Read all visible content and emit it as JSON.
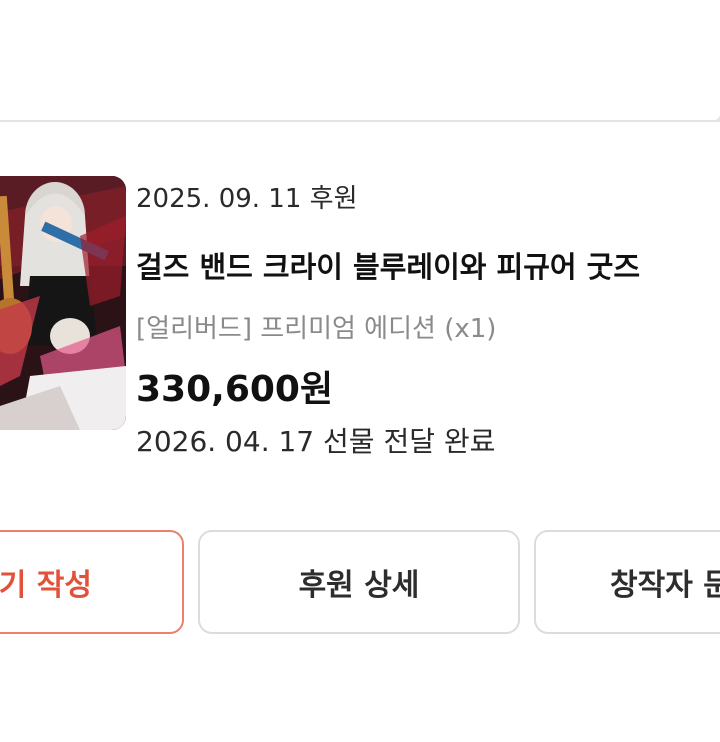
{
  "card": {
    "support_date": "2025. 09. 11 후원",
    "title": "걸즈 밴드 크라이 블루레이와 피규어 굿즈",
    "option": "[얼리버드] 프리미엄 에디션 (x1)",
    "price": "330,600원",
    "delivery": "2026. 04. 17 선물 전달 완료"
  },
  "buttons": {
    "review": "후기 작성",
    "detail": "후원 상세",
    "creator": "창작자 문의"
  },
  "colors": {
    "accent": "#e2523a",
    "accent_border": "#e8826f",
    "border": "#dcdcdc"
  }
}
